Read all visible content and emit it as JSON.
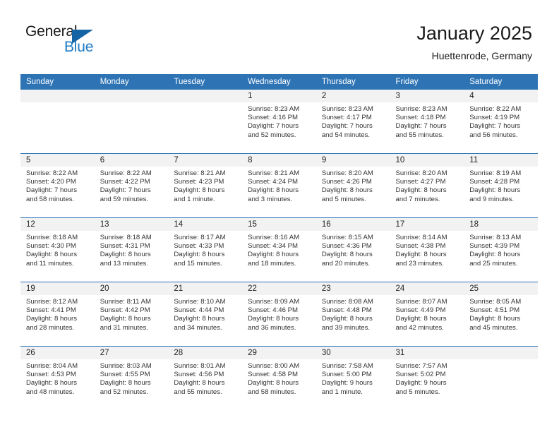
{
  "brand": {
    "word_one": "General",
    "word_two": "Blue",
    "triangle_icon": "triangle-icon",
    "accent_color": "#1464a5",
    "blue_text_color": "#1e7ac4"
  },
  "header": {
    "title": "January 2025",
    "subtitle": "Huettenrode, Germany"
  },
  "theme": {
    "header_row_bg": "#2e74b5",
    "header_row_text": "#ffffff",
    "daynum_band_bg": "#f2f2f2",
    "row_divider": "#2e74b5"
  },
  "weekday_headers": [
    "Sunday",
    "Monday",
    "Tuesday",
    "Wednesday",
    "Thursday",
    "Friday",
    "Saturday"
  ],
  "weeks": [
    [
      {
        "day": "",
        "empty": true,
        "sunrise": "",
        "sunset": "",
        "daylight_a": "",
        "daylight_b": ""
      },
      {
        "day": "",
        "empty": true,
        "sunrise": "",
        "sunset": "",
        "daylight_a": "",
        "daylight_b": ""
      },
      {
        "day": "",
        "empty": true,
        "sunrise": "",
        "sunset": "",
        "daylight_a": "",
        "daylight_b": ""
      },
      {
        "day": "1",
        "sunrise": "Sunrise: 8:23 AM",
        "sunset": "Sunset: 4:16 PM",
        "daylight_a": "Daylight: 7 hours",
        "daylight_b": "and 52 minutes."
      },
      {
        "day": "2",
        "sunrise": "Sunrise: 8:23 AM",
        "sunset": "Sunset: 4:17 PM",
        "daylight_a": "Daylight: 7 hours",
        "daylight_b": "and 54 minutes."
      },
      {
        "day": "3",
        "sunrise": "Sunrise: 8:23 AM",
        "sunset": "Sunset: 4:18 PM",
        "daylight_a": "Daylight: 7 hours",
        "daylight_b": "and 55 minutes."
      },
      {
        "day": "4",
        "sunrise": "Sunrise: 8:22 AM",
        "sunset": "Sunset: 4:19 PM",
        "daylight_a": "Daylight: 7 hours",
        "daylight_b": "and 56 minutes."
      }
    ],
    [
      {
        "day": "5",
        "sunrise": "Sunrise: 8:22 AM",
        "sunset": "Sunset: 4:20 PM",
        "daylight_a": "Daylight: 7 hours",
        "daylight_b": "and 58 minutes."
      },
      {
        "day": "6",
        "sunrise": "Sunrise: 8:22 AM",
        "sunset": "Sunset: 4:22 PM",
        "daylight_a": "Daylight: 7 hours",
        "daylight_b": "and 59 minutes."
      },
      {
        "day": "7",
        "sunrise": "Sunrise: 8:21 AM",
        "sunset": "Sunset: 4:23 PM",
        "daylight_a": "Daylight: 8 hours",
        "daylight_b": "and 1 minute."
      },
      {
        "day": "8",
        "sunrise": "Sunrise: 8:21 AM",
        "sunset": "Sunset: 4:24 PM",
        "daylight_a": "Daylight: 8 hours",
        "daylight_b": "and 3 minutes."
      },
      {
        "day": "9",
        "sunrise": "Sunrise: 8:20 AM",
        "sunset": "Sunset: 4:26 PM",
        "daylight_a": "Daylight: 8 hours",
        "daylight_b": "and 5 minutes."
      },
      {
        "day": "10",
        "sunrise": "Sunrise: 8:20 AM",
        "sunset": "Sunset: 4:27 PM",
        "daylight_a": "Daylight: 8 hours",
        "daylight_b": "and 7 minutes."
      },
      {
        "day": "11",
        "sunrise": "Sunrise: 8:19 AM",
        "sunset": "Sunset: 4:28 PM",
        "daylight_a": "Daylight: 8 hours",
        "daylight_b": "and 9 minutes."
      }
    ],
    [
      {
        "day": "12",
        "sunrise": "Sunrise: 8:18 AM",
        "sunset": "Sunset: 4:30 PM",
        "daylight_a": "Daylight: 8 hours",
        "daylight_b": "and 11 minutes."
      },
      {
        "day": "13",
        "sunrise": "Sunrise: 8:18 AM",
        "sunset": "Sunset: 4:31 PM",
        "daylight_a": "Daylight: 8 hours",
        "daylight_b": "and 13 minutes."
      },
      {
        "day": "14",
        "sunrise": "Sunrise: 8:17 AM",
        "sunset": "Sunset: 4:33 PM",
        "daylight_a": "Daylight: 8 hours",
        "daylight_b": "and 15 minutes."
      },
      {
        "day": "15",
        "sunrise": "Sunrise: 8:16 AM",
        "sunset": "Sunset: 4:34 PM",
        "daylight_a": "Daylight: 8 hours",
        "daylight_b": "and 18 minutes."
      },
      {
        "day": "16",
        "sunrise": "Sunrise: 8:15 AM",
        "sunset": "Sunset: 4:36 PM",
        "daylight_a": "Daylight: 8 hours",
        "daylight_b": "and 20 minutes."
      },
      {
        "day": "17",
        "sunrise": "Sunrise: 8:14 AM",
        "sunset": "Sunset: 4:38 PM",
        "daylight_a": "Daylight: 8 hours",
        "daylight_b": "and 23 minutes."
      },
      {
        "day": "18",
        "sunrise": "Sunrise: 8:13 AM",
        "sunset": "Sunset: 4:39 PM",
        "daylight_a": "Daylight: 8 hours",
        "daylight_b": "and 25 minutes."
      }
    ],
    [
      {
        "day": "19",
        "sunrise": "Sunrise: 8:12 AM",
        "sunset": "Sunset: 4:41 PM",
        "daylight_a": "Daylight: 8 hours",
        "daylight_b": "and 28 minutes."
      },
      {
        "day": "20",
        "sunrise": "Sunrise: 8:11 AM",
        "sunset": "Sunset: 4:42 PM",
        "daylight_a": "Daylight: 8 hours",
        "daylight_b": "and 31 minutes."
      },
      {
        "day": "21",
        "sunrise": "Sunrise: 8:10 AM",
        "sunset": "Sunset: 4:44 PM",
        "daylight_a": "Daylight: 8 hours",
        "daylight_b": "and 34 minutes."
      },
      {
        "day": "22",
        "sunrise": "Sunrise: 8:09 AM",
        "sunset": "Sunset: 4:46 PM",
        "daylight_a": "Daylight: 8 hours",
        "daylight_b": "and 36 minutes."
      },
      {
        "day": "23",
        "sunrise": "Sunrise: 8:08 AM",
        "sunset": "Sunset: 4:48 PM",
        "daylight_a": "Daylight: 8 hours",
        "daylight_b": "and 39 minutes."
      },
      {
        "day": "24",
        "sunrise": "Sunrise: 8:07 AM",
        "sunset": "Sunset: 4:49 PM",
        "daylight_a": "Daylight: 8 hours",
        "daylight_b": "and 42 minutes."
      },
      {
        "day": "25",
        "sunrise": "Sunrise: 8:05 AM",
        "sunset": "Sunset: 4:51 PM",
        "daylight_a": "Daylight: 8 hours",
        "daylight_b": "and 45 minutes."
      }
    ],
    [
      {
        "day": "26",
        "sunrise": "Sunrise: 8:04 AM",
        "sunset": "Sunset: 4:53 PM",
        "daylight_a": "Daylight: 8 hours",
        "daylight_b": "and 48 minutes."
      },
      {
        "day": "27",
        "sunrise": "Sunrise: 8:03 AM",
        "sunset": "Sunset: 4:55 PM",
        "daylight_a": "Daylight: 8 hours",
        "daylight_b": "and 52 minutes."
      },
      {
        "day": "28",
        "sunrise": "Sunrise: 8:01 AM",
        "sunset": "Sunset: 4:56 PM",
        "daylight_a": "Daylight: 8 hours",
        "daylight_b": "and 55 minutes."
      },
      {
        "day": "29",
        "sunrise": "Sunrise: 8:00 AM",
        "sunset": "Sunset: 4:58 PM",
        "daylight_a": "Daylight: 8 hours",
        "daylight_b": "and 58 minutes."
      },
      {
        "day": "30",
        "sunrise": "Sunrise: 7:58 AM",
        "sunset": "Sunset: 5:00 PM",
        "daylight_a": "Daylight: 9 hours",
        "daylight_b": "and 1 minute."
      },
      {
        "day": "31",
        "sunrise": "Sunrise: 7:57 AM",
        "sunset": "Sunset: 5:02 PM",
        "daylight_a": "Daylight: 9 hours",
        "daylight_b": "and 5 minutes."
      },
      {
        "day": "",
        "empty": true,
        "sunrise": "",
        "sunset": "",
        "daylight_a": "",
        "daylight_b": ""
      }
    ]
  ]
}
